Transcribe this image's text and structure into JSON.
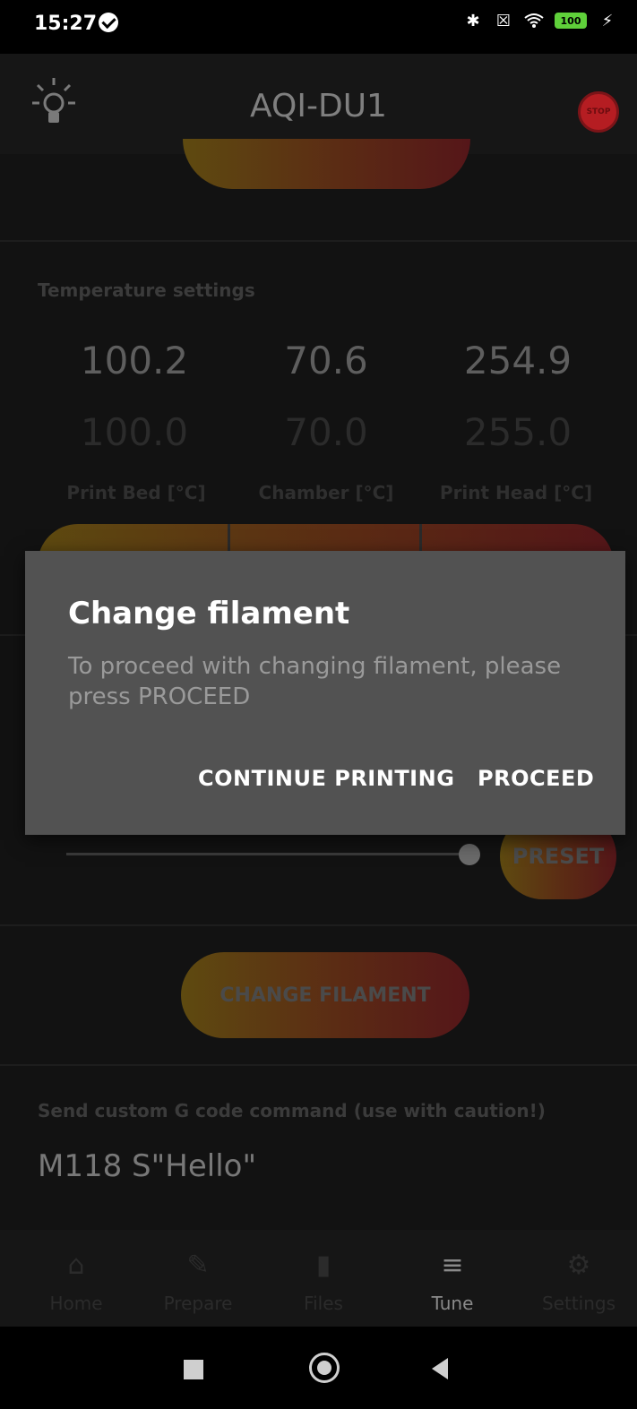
{
  "status_bar": {
    "time": "15:27",
    "battery": "100"
  },
  "app_bar": {
    "title": "AQI-DU1",
    "stop_label": "STOP"
  },
  "temperature": {
    "section_title": "Temperature settings",
    "columns": [
      {
        "current": "100.2",
        "target": "100.0",
        "label": "Print Bed [°C]"
      },
      {
        "current": "70.6",
        "target": "70.0",
        "label": "Chamber [°C]"
      },
      {
        "current": "254.9",
        "target": "255.0",
        "label": "Print Head [°C]"
      }
    ]
  },
  "flow": {
    "preset_label": "PRESET"
  },
  "change_filament_button": "CHANGE FILAMENT",
  "gcode": {
    "section_title": "Send custom G code command (use with caution!)",
    "value": "M118 S\"Hello\""
  },
  "bottom_nav": {
    "items": [
      {
        "label": "Home",
        "icon": "home-icon"
      },
      {
        "label": "Prepare",
        "icon": "pencil-icon"
      },
      {
        "label": "Files",
        "icon": "sd-card-icon"
      },
      {
        "label": "Tune",
        "icon": "sliders-icon"
      },
      {
        "label": "Settings",
        "icon": "gear-icon"
      }
    ],
    "active": "Tune"
  },
  "dialog": {
    "title": "Change filament",
    "message": "To proceed with changing filament, please press PROCEED",
    "continue_label": "CONTINUE PRINTING",
    "proceed_label": "PROCEED"
  },
  "colors": {
    "accent_gradient_start": "#E0AE2C",
    "accent_gradient_end": "#D02A2F",
    "dialog_background": "#525252"
  }
}
